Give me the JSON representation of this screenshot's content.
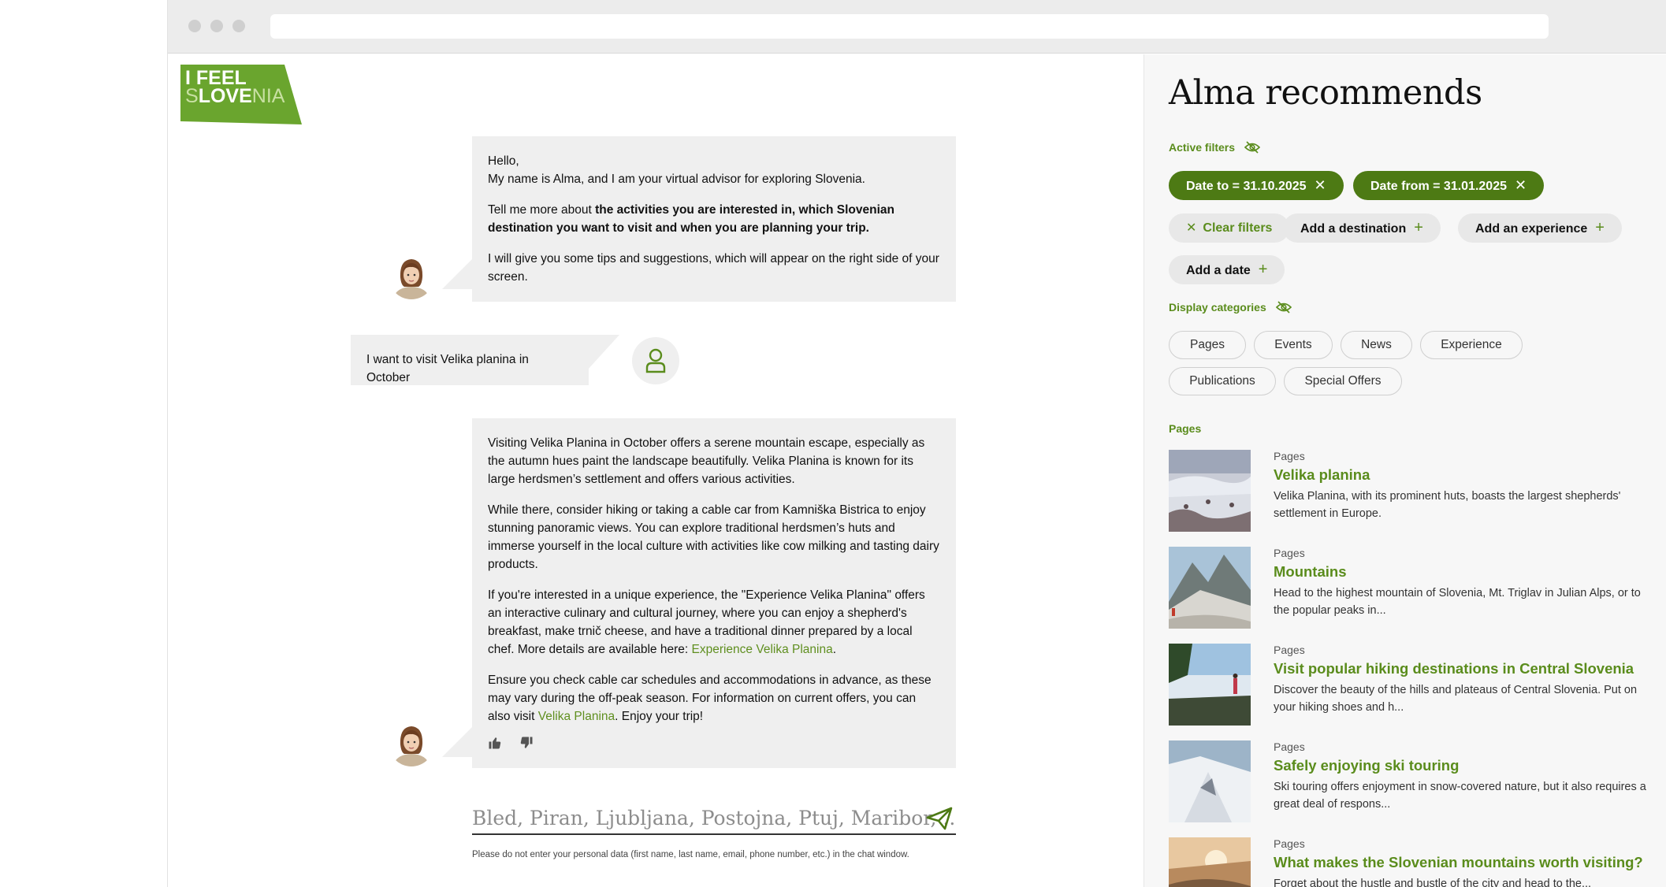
{
  "chat": {
    "logo": {
      "line1": "I FEEL",
      "line2_bold_a": "S",
      "line2_bold_b": "LOVE",
      "line2_light": "NIA"
    },
    "alma_greeting": {
      "p1_line1": "Hello,",
      "p1_line2": "My name is Alma, and I am your virtual advisor for exploring Slovenia.",
      "p2_intro": "Tell me more about ",
      "p2_bold": "the activities you are interested in, which Slovenian destination you want to visit and when you are planning your trip.",
      "p3": "I will give you some tips and suggestions, which will appear on the right side of your screen."
    },
    "user_message": "I want to visit Velika planina in October",
    "alma_reply": {
      "p1": "Visiting Velika Planina in October offers a serene mountain escape, especially as the autumn hues paint the landscape beautifully. Velika Planina is known for its large herdsmen’s settlement and offers various activities.",
      "p2": "While there, consider hiking or taking a cable car from Kamniška Bistrica to enjoy stunning panoramic views. You can explore traditional herdsmen’s huts and immerse yourself in the local culture with activities like cow milking and tasting dairy products.",
      "p3_text": "If you're interested in a unique experience, the \"Experience Velika Planina\" offers an interactive culinary and cultural journey, where you can enjoy a shepherd's breakfast, make trnič cheese, and have a traditional dinner prepared by a local chef. More details are available here: ",
      "p3_link": "Experience Velika Planina",
      "p3_end": ".",
      "p4_text": "Ensure you check cable car schedules and accommodations in advance, as these may vary during the off-peak season. For information on current offers, you can also visit ",
      "p4_link": "Velika Planina",
      "p4_end": ". Enjoy your trip!"
    },
    "input_placeholder": "Bled, Piran, Ljubljana, Postojna, Ptuj, Maribor, ..",
    "disclaimer": "Please do not enter your personal data (first name, last name, email, phone number, etc.) in the chat window."
  },
  "panel": {
    "title": "Alma recommends",
    "active_filters_label": "Active filters",
    "active_filters": [
      {
        "label": "Date to = 31.10.2025",
        "remove": "✕"
      },
      {
        "label": "Date from = 31.01.2025",
        "remove": "✕"
      }
    ],
    "actions": {
      "clear": "Clear filters",
      "clear_icon": "✕",
      "add_destination": "Add a destination",
      "add_experience": "Add an experience",
      "add_date": "Add a date",
      "plus": "+"
    },
    "display_categories_label": "Display categories",
    "categories": [
      "Pages",
      "Events",
      "News",
      "Experience",
      "Publications",
      "Special Offers"
    ],
    "results_section_label": "Pages",
    "results": [
      {
        "category": "Pages",
        "title": "Velika planina",
        "desc": "Velika Planina, with its prominent huts, boasts the largest shepherds' settlement in Europe."
      },
      {
        "category": "Pages",
        "title": "Mountains",
        "desc": "Head to the highest mountain of Slovenia, Mt. Triglav in Julian Alps, or to the popular peaks in..."
      },
      {
        "category": "Pages",
        "title": "Visit popular hiking destinations in Central Slovenia",
        "desc": "Discover the beauty of the hills and plateaus of Central Slovenia. Put on your hiking shoes and h..."
      },
      {
        "category": "Pages",
        "title": "Safely enjoying ski touring",
        "desc": "Ski touring offers enjoyment in snow-covered nature, but it also requires a great deal of respons..."
      },
      {
        "category": "Pages",
        "title": "What makes the Slovenian mountains worth visiting?",
        "desc": "Forget about the hustle and bustle of the city and head to the..."
      }
    ]
  },
  "colors": {
    "accent": "#5a8c1c",
    "chip_dark": "#4d7a14",
    "bubble": "#efefef",
    "logo_green": "#6aa52e"
  }
}
